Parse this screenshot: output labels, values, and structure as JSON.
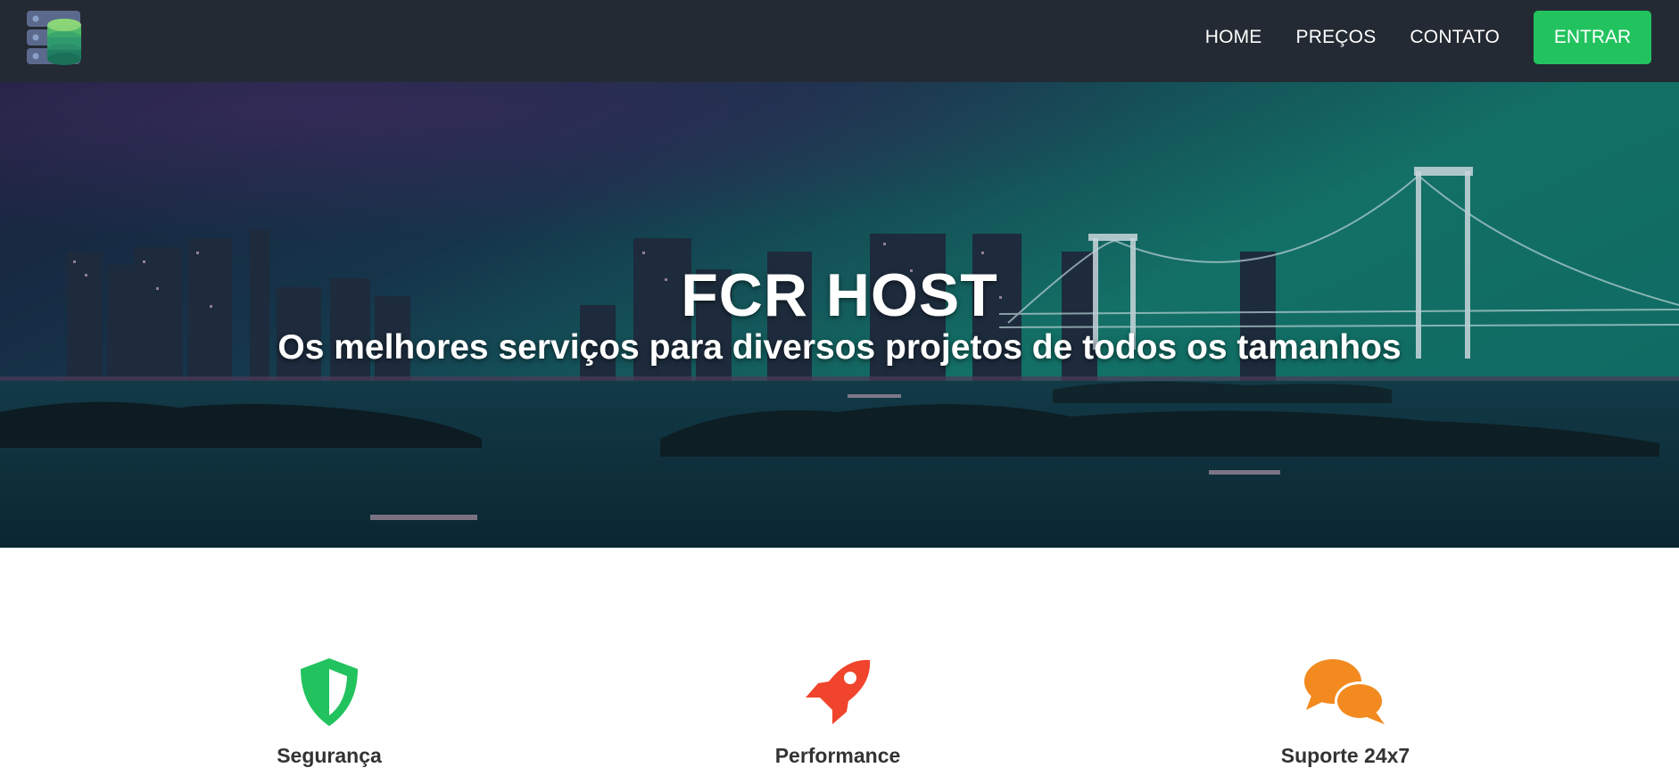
{
  "header": {
    "logo_icon": "database-server-icon",
    "nav": [
      {
        "label": "HOME"
      },
      {
        "label": "PREÇOS"
      },
      {
        "label": "CONTATO"
      }
    ],
    "enter_label": "ENTRAR"
  },
  "hero": {
    "title": "FCR HOST",
    "subtitle": "Os melhores serviços para diversos projetos de todos os tamanhos",
    "background": "night-city-bridge-image"
  },
  "features": [
    {
      "label": "Segurança",
      "icon": "shield-icon",
      "color": "#22c35e"
    },
    {
      "label": "Performance",
      "icon": "rocket-icon",
      "color": "#f0442c"
    },
    {
      "label": "Suporte 24x7",
      "icon": "chat-bubbles-icon",
      "color": "#f28a1f"
    }
  ],
  "colors": {
    "navbar": "#232a33",
    "accent": "#22c35e",
    "text_dark": "#333333"
  }
}
